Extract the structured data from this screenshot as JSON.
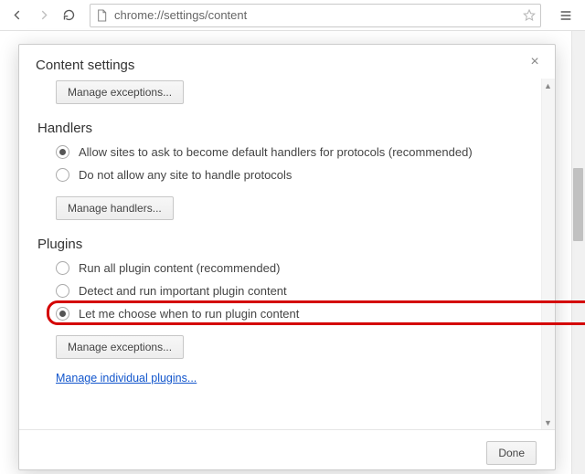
{
  "toolbar": {
    "url": "chrome://settings/content"
  },
  "dialog": {
    "title": "Content settings",
    "done_label": "Done",
    "top_button": "Manage exceptions...",
    "handlers": {
      "header": "Handlers",
      "opt_allow": "Allow sites to ask to become default handlers for protocols (recommended)",
      "opt_block": "Do not allow any site to handle protocols",
      "button": "Manage handlers..."
    },
    "plugins": {
      "header": "Plugins",
      "opt_runall": "Run all plugin content (recommended)",
      "opt_detect": "Detect and run important plugin content",
      "opt_choose": "Let me choose when to run plugin content",
      "button": "Manage exceptions...",
      "link": "Manage individual plugins..."
    }
  }
}
